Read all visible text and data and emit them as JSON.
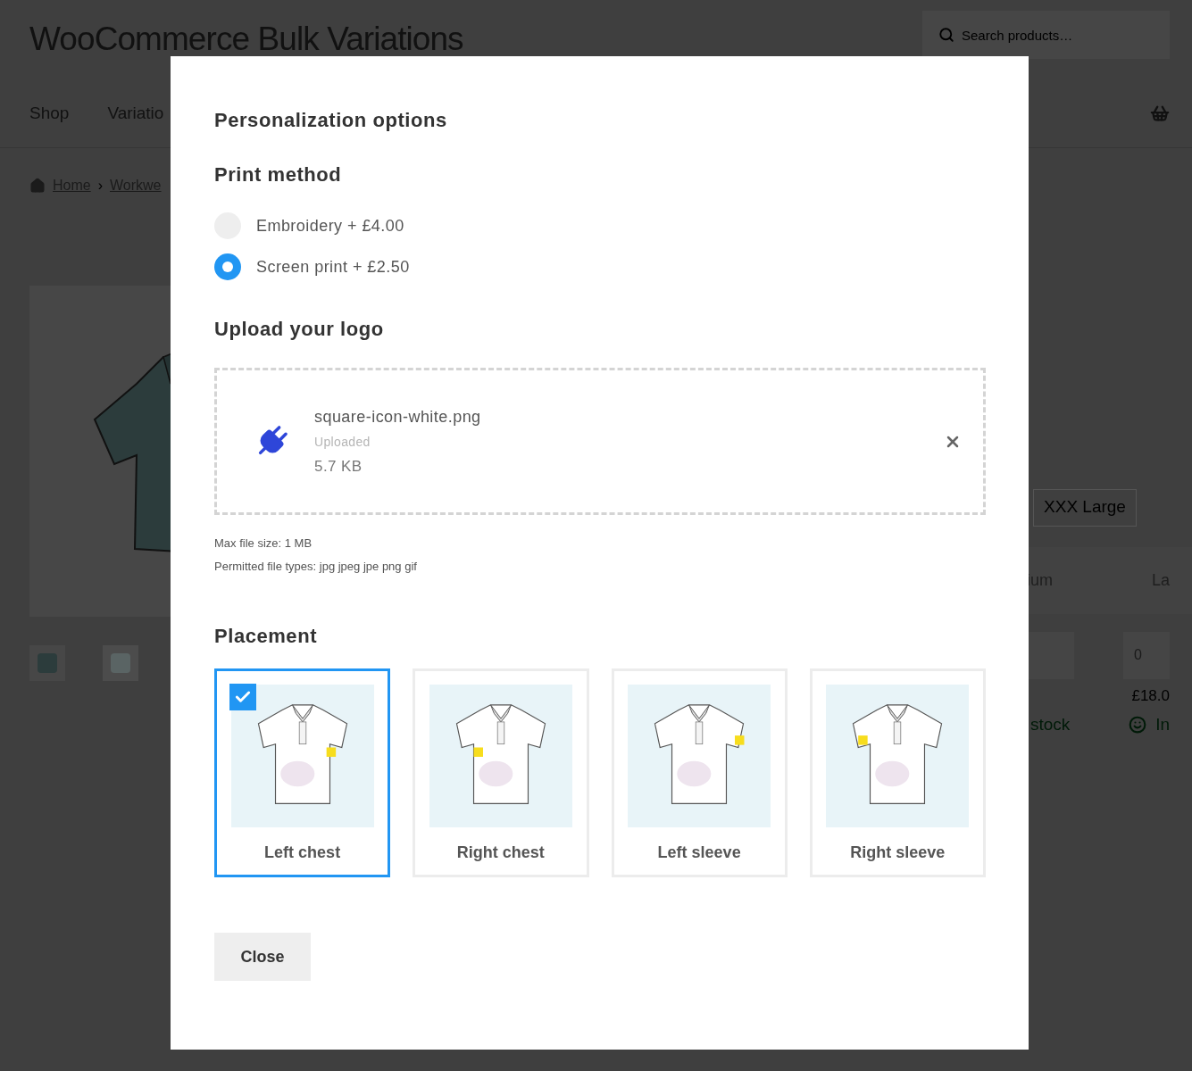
{
  "site": {
    "title": "WooCommerce Bulk Variations",
    "search": {
      "placeholder": "Search products…"
    },
    "nav": [
      "Shop",
      "Variatio"
    ],
    "breadcrumb": [
      "Home",
      "Workwe"
    ],
    "breadcrumb_separator": "›",
    "size_button": "XXX Large",
    "table": {
      "columns": [
        "ium",
        "La"
      ],
      "quantity": "0",
      "prices": [
        "£18.0"
      ],
      "stock": [
        "stock",
        "In"
      ]
    }
  },
  "modal": {
    "title": "Personalization options",
    "print_method": {
      "heading": "Print method",
      "options": [
        {
          "label": "Embroidery + £4.00",
          "selected": false
        },
        {
          "label": "Screen print + £2.50",
          "selected": true
        }
      ]
    },
    "upload": {
      "heading": "Upload your logo",
      "file": {
        "name": "square-icon-white.png",
        "status": "Uploaded",
        "size": "5.7 KB"
      },
      "notes": [
        "Max file size: 1 MB",
        "Permitted file types: jpg jpeg jpe png gif"
      ]
    },
    "placement": {
      "heading": "Placement",
      "options": [
        {
          "label": "Left chest",
          "selected": true
        },
        {
          "label": "Right chest",
          "selected": false
        },
        {
          "label": "Left sleeve",
          "selected": false
        },
        {
          "label": "Right sleeve",
          "selected": false
        }
      ]
    },
    "close": "Close"
  }
}
